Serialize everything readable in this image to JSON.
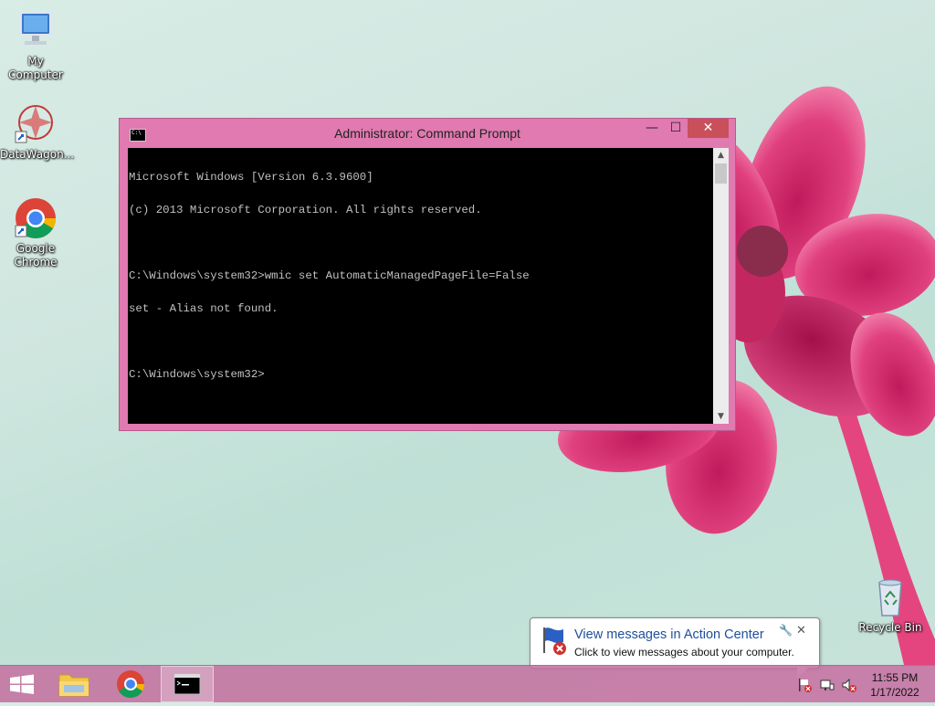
{
  "desktop": {
    "icons": [
      {
        "label": "My Computer"
      },
      {
        "label": "DataWagon..."
      },
      {
        "label": "Google Chrome"
      },
      {
        "label": "Recycle Bin"
      }
    ]
  },
  "window": {
    "title": "Administrator: Command Prompt",
    "system_icon_text": "C:\\",
    "minimize_label": "—",
    "maximize_label": "☐",
    "close_label": "✕",
    "console_lines": [
      "Microsoft Windows [Version 6.3.9600]",
      "(c) 2013 Microsoft Corporation. All rights reserved.",
      "",
      "C:\\Windows\\system32>wmic set AutomaticManagedPageFile=False",
      "set - Alias not found.",
      "",
      "C:\\Windows\\system32>"
    ]
  },
  "balloon": {
    "title": "View messages in Action Center",
    "body": "Click to view messages about your computer.",
    "close_label": "✕"
  },
  "taskbar": {
    "time": "11:55 PM",
    "date": "1/17/2022"
  },
  "colors": {
    "accent": "#e07ab0",
    "close_button": "#c9505a",
    "taskbar": "#c66ea0"
  }
}
